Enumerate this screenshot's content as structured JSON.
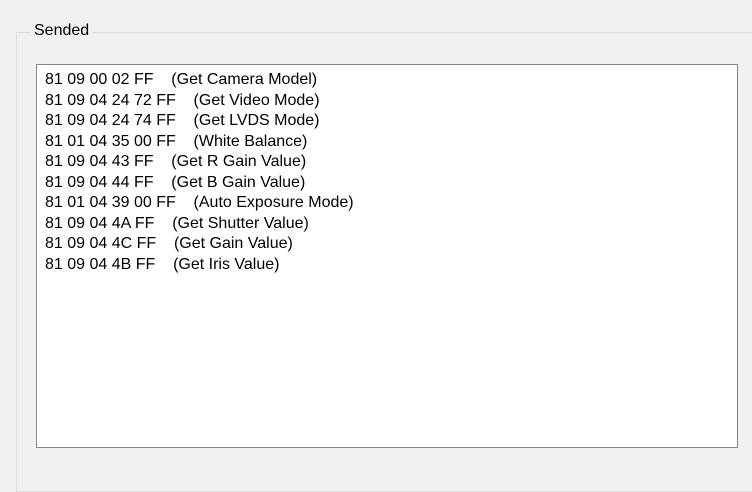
{
  "groupbox": {
    "title": "Sended"
  },
  "log": {
    "lines": [
      "81 09 00 02 FF    (Get Camera Model)",
      "81 09 04 24 72 FF    (Get Video Mode)",
      "81 09 04 24 74 FF    (Get LVDS Mode)",
      "81 01 04 35 00 FF    (White Balance)",
      "81 09 04 43 FF    (Get R Gain Value)",
      "81 09 04 44 FF    (Get B Gain Value)",
      "81 01 04 39 00 FF    (Auto Exposure Mode)",
      "81 09 04 4A FF    (Get Shutter Value)",
      "81 09 04 4C FF    (Get Gain Value)",
      "81 09 04 4B FF    (Get Iris Value)"
    ]
  }
}
